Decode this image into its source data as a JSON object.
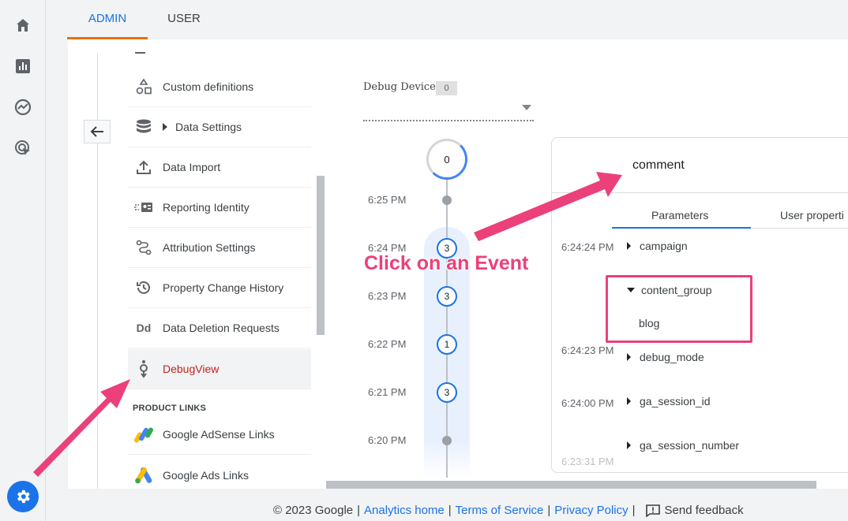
{
  "tabs": {
    "admin": "ADMIN",
    "user": "USER"
  },
  "menu": {
    "items": [
      {
        "label": "Custom definitions",
        "icon": "shapes-icon"
      },
      {
        "label": "Data Settings",
        "icon": "database-icon"
      },
      {
        "label": "Data Import",
        "icon": "upload-icon"
      },
      {
        "label": "Reporting Identity",
        "icon": "identity-icon"
      },
      {
        "label": "Attribution Settings",
        "icon": "attribution-icon"
      },
      {
        "label": "Property Change History",
        "icon": "history-icon"
      },
      {
        "label": "Data Deletion Requests",
        "icon": "dd-icon"
      },
      {
        "label": "DebugView",
        "icon": "debug-icon"
      }
    ],
    "section_label": "PRODUCT LINKS",
    "links": [
      {
        "label": "Google AdSense Links",
        "icon": "adsense-icon"
      },
      {
        "label": "Google Ads Links",
        "icon": "google-ads-icon"
      }
    ],
    "dd_icon_text": "Dd"
  },
  "debug": {
    "label": "Debug Device",
    "count": "0"
  },
  "timeline": {
    "top_count": "0",
    "times": [
      "6:25 PM",
      "6:24 PM",
      "6:23 PM",
      "6:22 PM",
      "6:21 PM",
      "6:20 PM"
    ],
    "counts": [
      "3",
      "3",
      "1",
      "3"
    ]
  },
  "event": {
    "title": "comment",
    "tabs": {
      "params": "Parameters",
      "user": "User properti"
    },
    "params": [
      {
        "time": "6:24:24 PM",
        "name": "campaign"
      },
      {
        "time": "",
        "name": "content_group",
        "value": "blog"
      },
      {
        "time": "6:24:23 PM",
        "name": "debug_mode"
      },
      {
        "time": "6:24:00 PM",
        "name": "ga_session_id"
      },
      {
        "time": "6:23:31 PM",
        "name": "ga_session_number"
      }
    ]
  },
  "annotation": {
    "text": "Click on an Event",
    "color": "#ec407a"
  },
  "footer": {
    "copyright": "© 2023 Google",
    "links": [
      "Analytics home",
      "Terms of Service",
      "Privacy Policy"
    ],
    "separator": "|",
    "feedback": "Send feedback"
  },
  "colors": {
    "accent": "#1a73e8",
    "active": "#c5221f",
    "tab_underline": "#e37400"
  }
}
